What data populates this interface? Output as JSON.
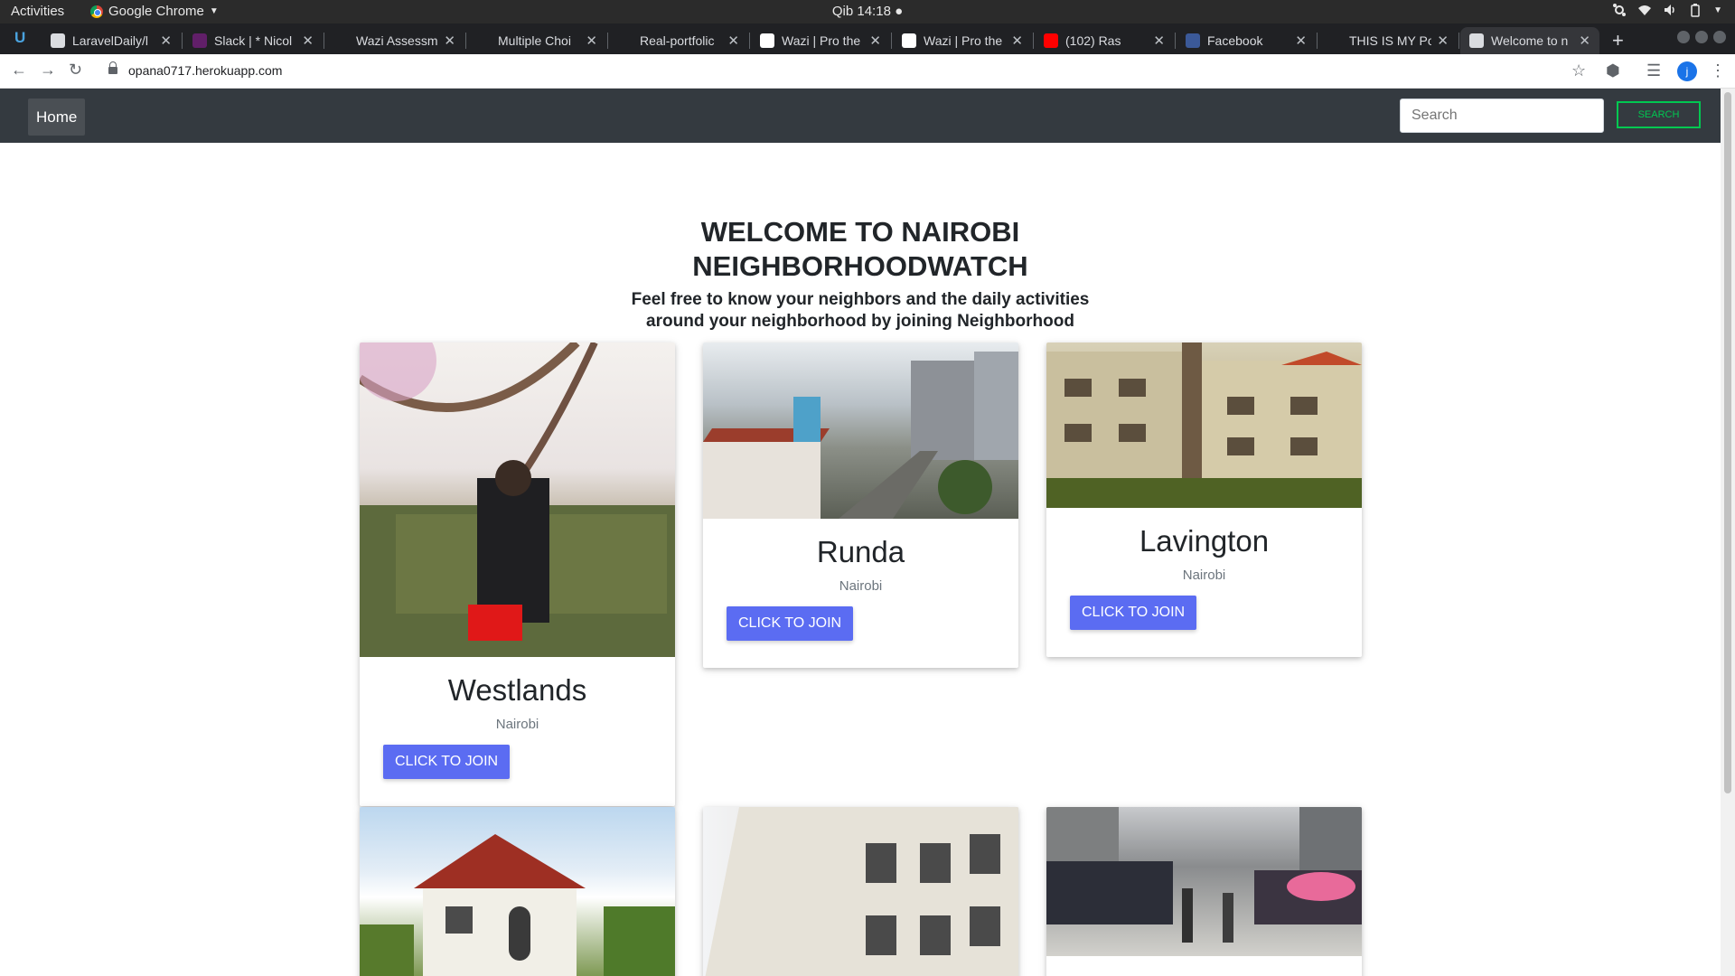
{
  "os_bar": {
    "activities": "Activities",
    "app_name": "Google Chrome",
    "clock": "Qib 14:18 ●"
  },
  "browser": {
    "tabs": [
      {
        "title": "LaravelDaily/l",
        "favicon": "github-icon",
        "color": "#dadce0"
      },
      {
        "title": "Slack | * Nicol",
        "favicon": "slack-icon",
        "color": "#611f69"
      },
      {
        "title": "Wazi Assessm",
        "favicon": "blank-icon",
        "color": "#202124"
      },
      {
        "title": "Multiple Choi",
        "favicon": "blank-icon",
        "color": "#202124"
      },
      {
        "title": "Real-portfolic",
        "favicon": "blank-icon",
        "color": "#202124"
      },
      {
        "title": "Wazi | Pro the",
        "favicon": "doc-icon",
        "color": "#ffffff"
      },
      {
        "title": "Wazi | Pro the",
        "favicon": "doc-icon",
        "color": "#ffffff"
      },
      {
        "title": "(102) Ras",
        "favicon": "youtube-icon",
        "color": "#ff0000"
      },
      {
        "title": "Facebook",
        "favicon": "facebook-icon",
        "color": "#3b5998"
      },
      {
        "title": "THIS IS MY Po",
        "favicon": "blank-icon",
        "color": "#202124"
      },
      {
        "title": "Welcome to n",
        "favicon": "globe-icon",
        "color": "#dadce0",
        "active": true
      }
    ],
    "url": "opana0717.herokuapp.com",
    "profile_initial": "j"
  },
  "site": {
    "nav": {
      "home": "Home",
      "search_placeholder": "Search",
      "search_button": "Search"
    },
    "hero": {
      "title": "WELCOME TO NAIROBI NEIGHBORHOODWATCH",
      "subtitle": "Feel free to know your neighbors and the daily activities around your neighborhood by joining Neighborhood"
    },
    "cards": [
      {
        "name": "Westlands",
        "city": "Nairobi",
        "button": "CLICK TO JOIN",
        "image": "man-with-backpack-photo"
      },
      {
        "name": "Runda",
        "city": "Nairobi",
        "button": "CLICK TO JOIN",
        "image": "city-street-aerial-photo"
      },
      {
        "name": "Lavington",
        "city": "Nairobi",
        "button": "CLICK TO JOIN",
        "image": "apartment-building-photo"
      },
      {
        "name": "",
        "city": "",
        "button": "",
        "image": "villa-house-photo"
      },
      {
        "name": "",
        "city": "",
        "button": "",
        "image": "apartment-block-photo"
      },
      {
        "name": "",
        "city": "",
        "button": "",
        "image": "street-market-photo"
      }
    ]
  },
  "colors": {
    "navbar": "#343a40",
    "join_button": "#5b6cf2",
    "search_button": "#00c851"
  }
}
